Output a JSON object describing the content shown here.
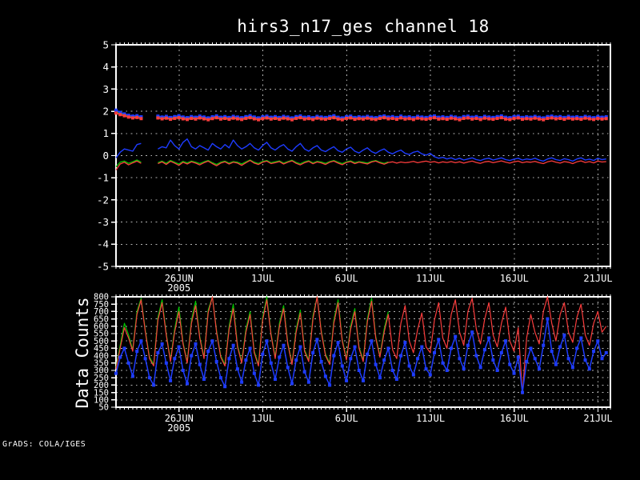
{
  "app": {
    "credit": "GrADS: COLA/IGES"
  },
  "colors": {
    "background": "#000000",
    "foreground": "#ffffff",
    "grid": "#b4b4b4",
    "red": "#fa3c3c",
    "green": "#00c800",
    "blue": "#1e3cff"
  },
  "chart_data": [
    {
      "type": "line",
      "panel": "top",
      "title": "hirs3_n17_ges channel 18",
      "xlabel": "",
      "ylabel": "",
      "ylim": [
        -5,
        5
      ],
      "ytick_step": 1,
      "xlim": [
        0,
        29.5
      ],
      "x_unit": "days since 22JUN2005 06Z",
      "x_step": 0.25,
      "x_minor_tick_step": 0.25,
      "grid": true,
      "x_ticks": [
        {
          "label": "26JUN",
          "sublabel": "2005",
          "t": 3.76
        },
        {
          "label": "1JUL",
          "t": 8.76
        },
        {
          "label": "6JUL",
          "t": 13.76
        },
        {
          "label": "11JUL",
          "t": 18.76
        },
        {
          "label": "16JUL",
          "t": 23.76
        },
        {
          "label": "21JUL",
          "t": 28.76
        }
      ],
      "series": [
        {
          "name": "stdev-green",
          "color": "#00c800",
          "width": 1.6,
          "marker": "square",
          "marker_size": 4,
          "values": [
            1.98,
            1.9,
            1.84,
            1.78,
            1.74,
            1.76,
            1.71,
            null,
            null,
            null,
            1.74,
            1.7,
            1.73,
            1.68,
            1.72,
            1.75,
            1.7,
            1.67,
            1.72,
            1.69,
            1.74,
            1.7,
            1.66,
            1.71,
            1.75,
            1.69,
            1.72,
            1.68,
            1.73,
            1.7,
            1.67,
            1.72,
            1.75,
            1.7,
            1.66,
            1.71,
            1.74,
            1.69,
            1.72,
            1.68,
            1.73,
            1.7,
            1.66,
            1.72,
            1.75,
            1.69,
            1.71,
            1.67,
            1.73,
            1.7,
            1.68,
            1.72,
            1.75,
            1.69,
            1.66,
            1.72,
            1.74,
            1.68,
            1.71,
            1.69,
            1.73,
            1.69,
            1.67,
            1.72,
            1.75,
            1.7
          ]
        },
        {
          "name": "stdev-blue",
          "color": "#1e3cff",
          "width": 1.6,
          "marker": "square",
          "marker_size": 4,
          "values": [
            2.05,
            1.95,
            1.88,
            1.82,
            1.78,
            1.8,
            1.75,
            null,
            null,
            null,
            1.78,
            1.74,
            1.77,
            1.72,
            1.76,
            1.8,
            1.74,
            1.71,
            1.76,
            1.73,
            1.78,
            1.74,
            1.7,
            1.75,
            1.79,
            1.73,
            1.76,
            1.72,
            1.77,
            1.74,
            1.71,
            1.76,
            1.8,
            1.74,
            1.7,
            1.75,
            1.78,
            1.73,
            1.76,
            1.72,
            1.77,
            1.74,
            1.7,
            1.76,
            1.79,
            1.73,
            1.75,
            1.71,
            1.77,
            1.74,
            1.72,
            1.76,
            1.8,
            1.73,
            1.7,
            1.76,
            1.78,
            1.72,
            1.75,
            1.73,
            1.77,
            1.73,
            1.71,
            1.76,
            1.79,
            1.74,
            1.76,
            1.72,
            1.78,
            1.73,
            1.75,
            1.71,
            1.77,
            1.74,
            1.72,
            1.76,
            1.79,
            1.73,
            1.75,
            1.72,
            1.77,
            1.74,
            1.7,
            1.76,
            1.78,
            1.73,
            1.76,
            1.71,
            1.77,
            1.74,
            1.72,
            1.76,
            1.79,
            1.73,
            1.71,
            1.76,
            1.78,
            1.72,
            1.75,
            1.73,
            1.77,
            1.73,
            1.7,
            1.76,
            1.78,
            1.74,
            1.76,
            1.72,
            1.77,
            1.73,
            1.75,
            1.72,
            1.77,
            1.74,
            1.71,
            1.76,
            1.73,
            1.75
          ]
        },
        {
          "name": "stdev-red",
          "color": "#fa3c3c",
          "width": 1.6,
          "marker": "square",
          "marker_size": 4,
          "values": [
            1.92,
            1.85,
            1.8,
            1.74,
            1.7,
            1.72,
            1.67,
            null,
            null,
            null,
            1.7,
            1.66,
            1.69,
            1.64,
            1.68,
            1.71,
            1.66,
            1.63,
            1.68,
            1.65,
            1.7,
            1.66,
            1.62,
            1.67,
            1.71,
            1.65,
            1.68,
            1.64,
            1.69,
            1.66,
            1.63,
            1.68,
            1.71,
            1.66,
            1.62,
            1.67,
            1.7,
            1.65,
            1.68,
            1.64,
            1.69,
            1.66,
            1.62,
            1.68,
            1.71,
            1.65,
            1.67,
            1.63,
            1.69,
            1.66,
            1.64,
            1.68,
            1.71,
            1.65,
            1.62,
            1.68,
            1.7,
            1.64,
            1.67,
            1.65,
            1.69,
            1.65,
            1.63,
            1.68,
            1.71,
            1.66,
            1.68,
            1.64,
            1.7,
            1.65,
            1.67,
            1.63,
            1.69,
            1.66,
            1.64,
            1.68,
            1.71,
            1.65,
            1.67,
            1.64,
            1.69,
            1.66,
            1.62,
            1.68,
            1.7,
            1.65,
            1.68,
            1.63,
            1.69,
            1.66,
            1.64,
            1.68,
            1.71,
            1.65,
            1.63,
            1.68,
            1.7,
            1.64,
            1.67,
            1.65,
            1.69,
            1.65,
            1.62,
            1.68,
            1.7,
            1.66,
            1.68,
            1.64,
            1.69,
            1.65,
            1.67,
            1.64,
            1.69,
            1.66,
            1.63,
            1.68,
            1.65,
            1.67
          ]
        },
        {
          "name": "bias-green",
          "color": "#00c800",
          "width": 1.3,
          "values": [
            -0.5,
            -0.3,
            -0.25,
            -0.35,
            -0.28,
            -0.2,
            -0.3,
            null,
            null,
            null,
            -0.32,
            -0.25,
            -0.35,
            -0.22,
            -0.3,
            -0.38,
            -0.26,
            -0.33,
            -0.25,
            -0.3,
            -0.36,
            -0.28,
            -0.22,
            -0.32,
            -0.4,
            -0.3,
            -0.25,
            -0.34,
            -0.27,
            -0.3,
            -0.38,
            -0.28,
            -0.2,
            -0.3,
            -0.36,
            -0.26,
            -0.22,
            -0.32,
            -0.28,
            -0.24,
            -0.34,
            -0.27,
            -0.21,
            -0.31,
            -0.37,
            -0.28,
            -0.23,
            -0.33,
            -0.26,
            -0.29,
            -0.35,
            -0.27,
            -0.22,
            -0.3,
            -0.36,
            -0.28,
            -0.24,
            -0.32,
            -0.27,
            -0.3,
            -0.34,
            -0.26,
            -0.22,
            -0.3,
            -0.35,
            -0.28
          ]
        },
        {
          "name": "bias-blue",
          "color": "#1e3cff",
          "width": 1.4,
          "values": [
            -0.1,
            0.15,
            0.3,
            0.25,
            0.2,
            0.5,
            0.55,
            null,
            null,
            null,
            0.3,
            0.4,
            0.35,
            0.7,
            0.45,
            0.3,
            0.6,
            0.75,
            0.4,
            0.3,
            0.45,
            0.35,
            0.25,
            0.55,
            0.4,
            0.3,
            0.5,
            0.35,
            0.7,
            0.45,
            0.3,
            0.4,
            0.55,
            0.35,
            0.25,
            0.45,
            0.6,
            0.35,
            0.25,
            0.4,
            0.5,
            0.3,
            0.2,
            0.4,
            0.55,
            0.3,
            0.2,
            0.35,
            0.45,
            0.25,
            0.18,
            0.3,
            0.4,
            0.22,
            0.15,
            0.3,
            0.38,
            0.2,
            0.12,
            0.25,
            0.35,
            0.18,
            0.1,
            0.22,
            0.3,
            0.15,
            0.08,
            0.18,
            0.25,
            0.1,
            0.05,
            0.15,
            0.2,
            0.08,
            0.02,
            0.1,
            -0.05,
            -0.12,
            -0.08,
            -0.15,
            -0.1,
            -0.18,
            -0.12,
            -0.2,
            -0.15,
            -0.1,
            -0.18,
            -0.22,
            -0.15,
            -0.12,
            -0.2,
            -0.15,
            -0.1,
            -0.18,
            -0.22,
            -0.16,
            -0.12,
            -0.2,
            -0.15,
            -0.18,
            -0.12,
            -0.2,
            -0.25,
            -0.15,
            -0.1,
            -0.18,
            -0.22,
            -0.14,
            -0.18,
            -0.25,
            -0.15,
            -0.1,
            -0.2,
            -0.16,
            -0.22,
            -0.12,
            -0.18,
            -0.15
          ]
        },
        {
          "name": "bias-red",
          "color": "#fa3c3c",
          "width": 1.3,
          "values": [
            -0.65,
            -0.38,
            -0.3,
            -0.42,
            -0.33,
            -0.25,
            -0.35,
            null,
            null,
            null,
            -0.36,
            -0.28,
            -0.4,
            -0.26,
            -0.34,
            -0.44,
            -0.3,
            -0.38,
            -0.28,
            -0.34,
            -0.42,
            -0.32,
            -0.25,
            -0.36,
            -0.46,
            -0.34,
            -0.28,
            -0.38,
            -0.3,
            -0.34,
            -0.44,
            -0.32,
            -0.22,
            -0.34,
            -0.4,
            -0.3,
            -0.25,
            -0.36,
            -0.32,
            -0.27,
            -0.38,
            -0.3,
            -0.24,
            -0.35,
            -0.42,
            -0.32,
            -0.26,
            -0.37,
            -0.29,
            -0.33,
            -0.4,
            -0.3,
            -0.25,
            -0.34,
            -0.41,
            -0.31,
            -0.27,
            -0.36,
            -0.3,
            -0.34,
            -0.38,
            -0.29,
            -0.25,
            -0.33,
            -0.39,
            -0.31,
            -0.28,
            -0.34,
            -0.29,
            -0.32,
            -0.3,
            -0.26,
            -0.32,
            -0.28,
            -0.25,
            -0.3,
            -0.27,
            -0.33,
            -0.28,
            -0.31,
            -0.27,
            -0.32,
            -0.28,
            -0.34,
            -0.29,
            -0.25,
            -0.31,
            -0.35,
            -0.28,
            -0.26,
            -0.32,
            -0.28,
            -0.24,
            -0.3,
            -0.34,
            -0.28,
            -0.25,
            -0.32,
            -0.28,
            -0.3,
            -0.26,
            -0.32,
            -0.36,
            -0.28,
            -0.24,
            -0.3,
            -0.34,
            -0.27,
            -0.3,
            -0.36,
            -0.28,
            -0.24,
            -0.31,
            -0.27,
            -0.33,
            -0.25,
            -0.29,
            -0.27
          ]
        }
      ]
    },
    {
      "type": "line",
      "panel": "bottom",
      "title": "",
      "xlabel": "",
      "ylabel": "Data Counts",
      "ylim": [
        50,
        800
      ],
      "ytick_step": 50,
      "xlim": [
        0,
        29.5
      ],
      "x_unit": "days since 22JUN2005 06Z",
      "x_step": 0.25,
      "x_minor_tick_step": 0.25,
      "grid": true,
      "x_ticks": [
        {
          "label": "26JUN",
          "sublabel": "2005",
          "t": 3.76
        },
        {
          "label": "1JUL",
          "t": 8.76
        },
        {
          "label": "6JUL",
          "t": 13.76
        },
        {
          "label": "11JUL",
          "t": 18.76
        },
        {
          "label": "16JUL",
          "t": 23.76
        },
        {
          "label": "21JUL",
          "t": 28.76
        }
      ],
      "series": [
        {
          "name": "counts-green",
          "color": "#00c800",
          "width": 1.2,
          "values": [
            320,
            470,
            620,
            540,
            440,
            700,
            790,
            570,
            390,
            340,
            660,
            780,
            550,
            370,
            580,
            730,
            490,
            360,
            640,
            770,
            530,
            390,
            710,
            800,
            570,
            400,
            340,
            600,
            750,
            470,
            360,
            580,
            700,
            430,
            340,
            660,
            800,
            550,
            390,
            620,
            740,
            490,
            350,
            580,
            710,
            440,
            370,
            670,
            800,
            570,
            410,
            350,
            640,
            780,
            510,
            380,
            600,
            720,
            460,
            370,
            650,
            790,
            530,
            400,
            580,
            700
          ]
        },
        {
          "name": "counts-red",
          "color": "#fa3c3c",
          "width": 1.2,
          "values": [
            310,
            450,
            590,
            520,
            430,
            680,
            780,
            560,
            380,
            330,
            640,
            760,
            540,
            360,
            560,
            700,
            480,
            350,
            620,
            740,
            520,
            380,
            690,
            800,
            560,
            390,
            330,
            580,
            720,
            460,
            350,
            560,
            680,
            420,
            330,
            640,
            780,
            540,
            380,
            600,
            720,
            480,
            340,
            560,
            690,
            430,
            360,
            650,
            800,
            560,
            400,
            340,
            620,
            760,
            500,
            370,
            580,
            700,
            450,
            360,
            630,
            770,
            520,
            390,
            560,
            680,
            440,
            380,
            620,
            740,
            500,
            420,
            580,
            690,
            460,
            420,
            640,
            760,
            520,
            450,
            680,
            780,
            560,
            470,
            700,
            790,
            580,
            480,
            650,
            760,
            540,
            460,
            620,
            730,
            500,
            430,
            590,
            140,
            520,
            680,
            560,
            480,
            700,
            800,
            620,
            500,
            680,
            760,
            560,
            490,
            660,
            750,
            540,
            470,
            620,
            700,
            560,
            600
          ]
        },
        {
          "name": "counts-blue",
          "color": "#1e3cff",
          "width": 1.5,
          "marker": "square",
          "marker_size": 4,
          "values": [
            280,
            390,
            450,
            350,
            260,
            430,
            500,
            380,
            250,
            200,
            420,
            480,
            350,
            230,
            380,
            460,
            300,
            210,
            400,
            480,
            340,
            240,
            430,
            500,
            360,
            250,
            190,
            380,
            470,
            310,
            220,
            370,
            450,
            280,
            200,
            410,
            500,
            350,
            240,
            390,
            470,
            320,
            210,
            370,
            460,
            290,
            220,
            420,
            510,
            360,
            260,
            200,
            400,
            490,
            330,
            230,
            380,
            460,
            300,
            230,
            410,
            500,
            340,
            250,
            370,
            450,
            300,
            240,
            400,
            490,
            330,
            270,
            380,
            460,
            310,
            270,
            420,
            510,
            350,
            300,
            450,
            530,
            380,
            310,
            470,
            560,
            400,
            320,
            440,
            520,
            370,
            300,
            420,
            500,
            340,
            280,
            390,
            150,
            360,
            450,
            380,
            310,
            470,
            650,
            430,
            340,
            460,
            540,
            380,
            320,
            450,
            520,
            370,
            310,
            430,
            500,
            380,
            420
          ]
        }
      ]
    }
  ]
}
